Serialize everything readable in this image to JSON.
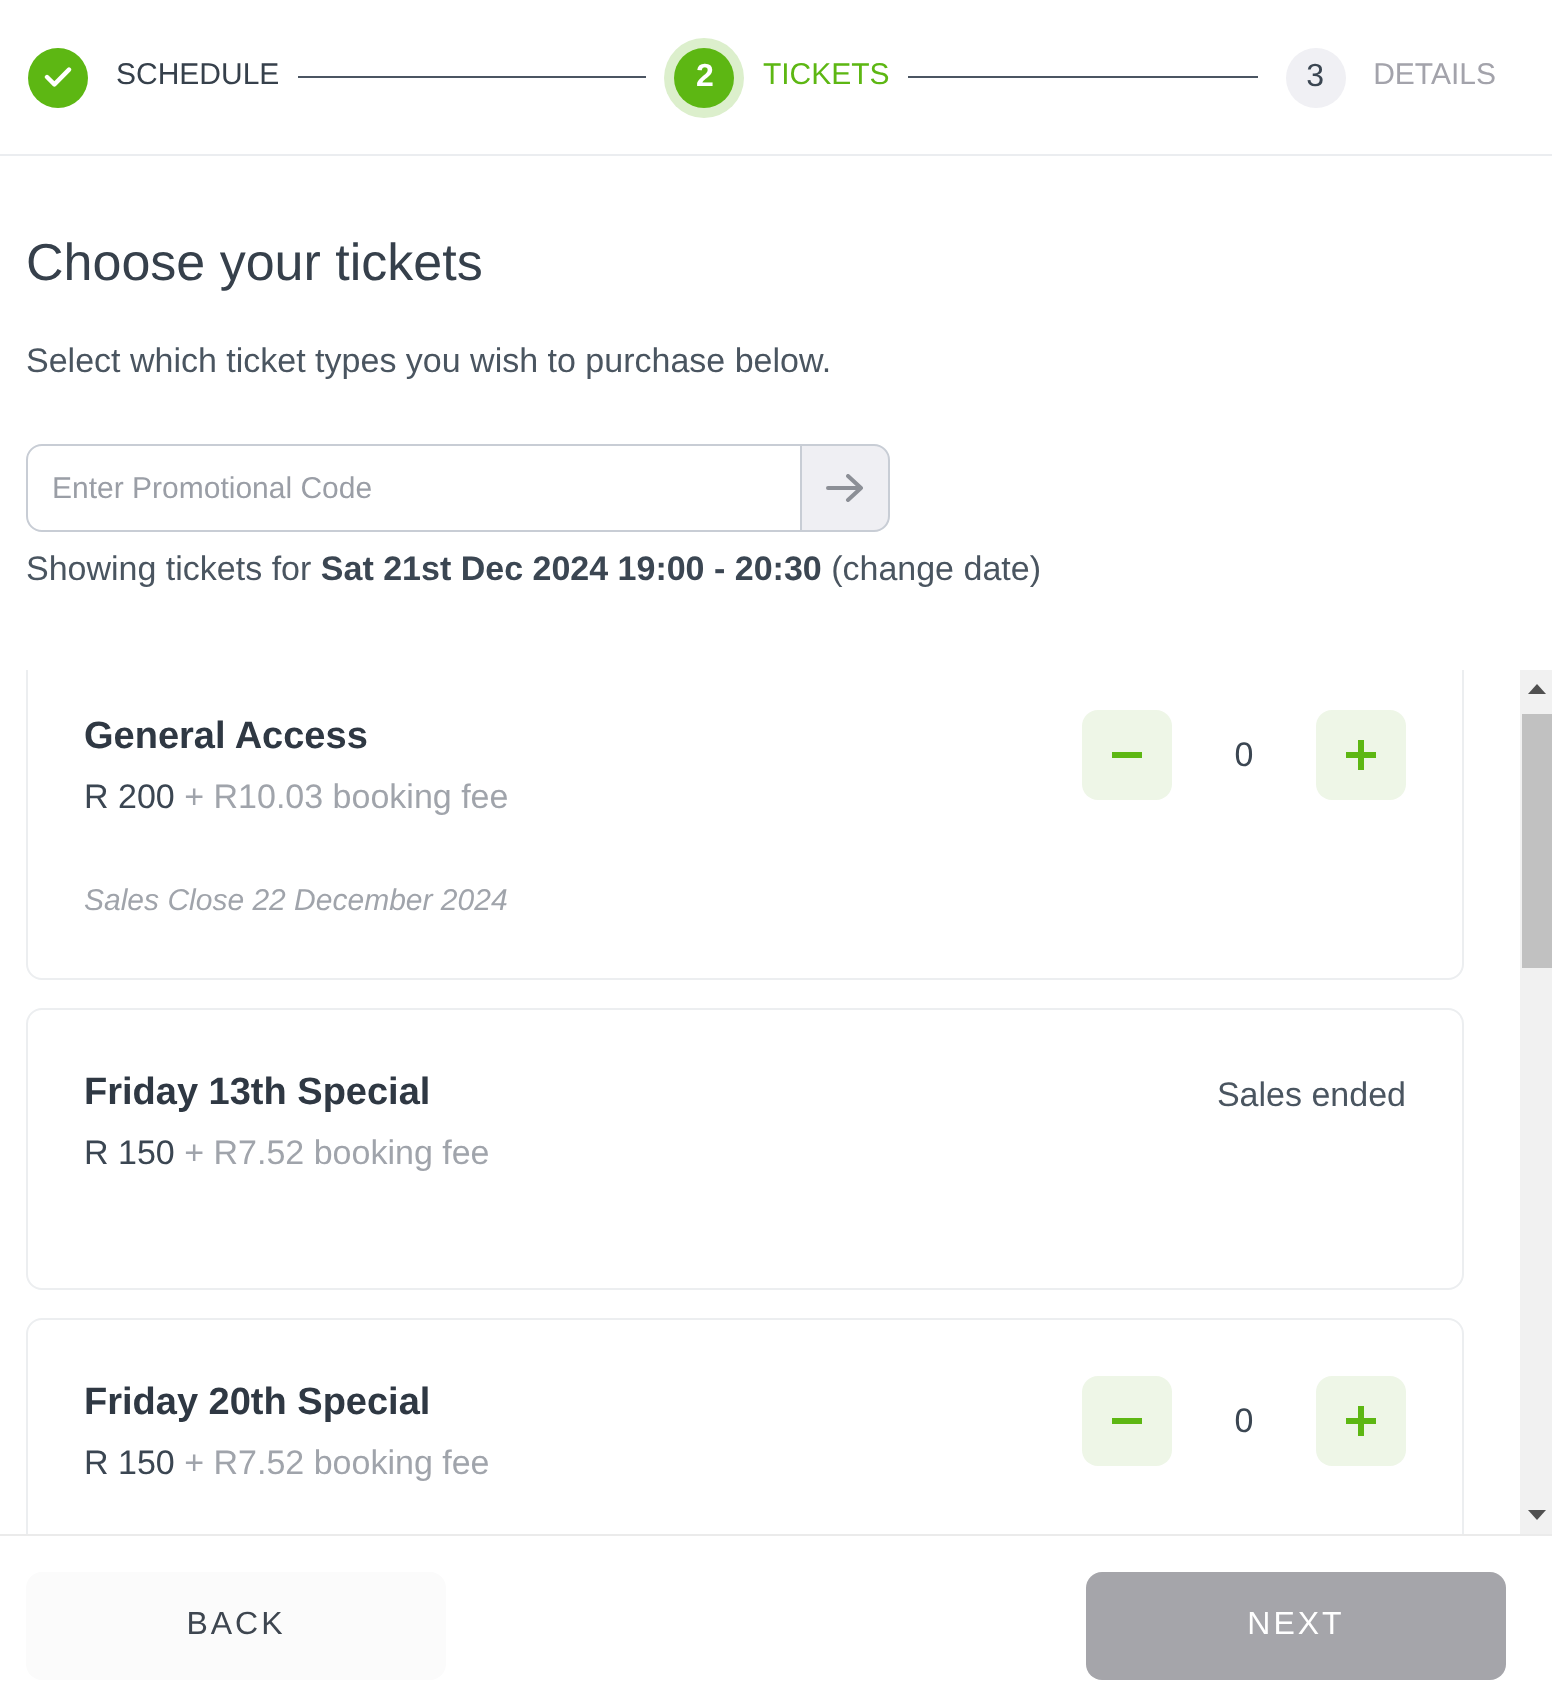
{
  "steps": [
    {
      "label": "SCHEDULE",
      "completed": true,
      "selected": false
    },
    {
      "number": "2",
      "label": "TICKETS",
      "completed": false,
      "selected": true
    },
    {
      "number": "3",
      "label": "DETAILS",
      "completed": false,
      "selected": false
    }
  ],
  "heading": "Choose your tickets",
  "intro": "Select which ticket types you wish to purchase below.",
  "promo": {
    "placeholder": "Enter Promotional Code"
  },
  "showing": "Showing tickets for **Sat 21st Dec 2024 19:00 - 20:30** (change date)",
  "tickets": [
    {
      "kind": "available",
      "name": "General Access",
      "price": "R 200",
      "fee": "+ R10.03 booking fee",
      "quantity": "0",
      "note": "Sales Close 22 December 2024"
    },
    {
      "kind": "ended",
      "name": "Friday 13th Special",
      "price": "R 150",
      "fee": "+ R7.52 booking fee",
      "status": "Sales ended"
    },
    {
      "kind": "available",
      "name": "Friday 20th Special",
      "price": "R 150",
      "fee": "+ R7.52 booking fee",
      "quantity": "0"
    }
  ],
  "footer": {
    "buttons": [
      {
        "kind": "secondary",
        "label": "BACK",
        "disabled": false
      },
      {
        "kind": "primary",
        "label": "NEXT",
        "disabled": true
      }
    ]
  }
}
